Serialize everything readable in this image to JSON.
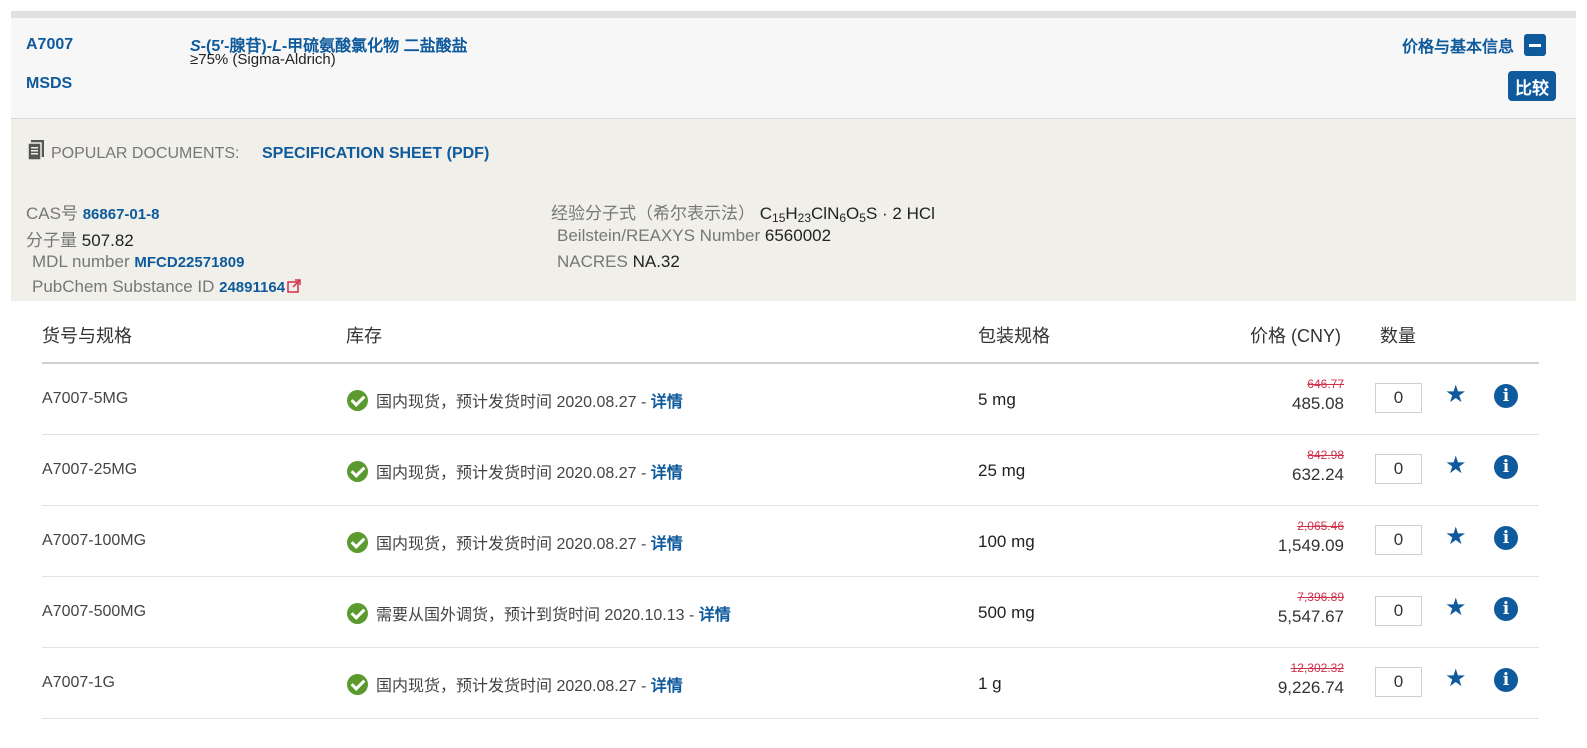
{
  "header": {
    "sku": "A7007",
    "msds": "MSDS",
    "product_name_prefix": "S",
    "product_name_mid": "-(5′-腺苷)-",
    "product_name_italic2": "L",
    "product_name_suffix": "-甲硫氨酸氯化物 二盐酸盐",
    "product_subtitle": "≥75% (Sigma-Aldrich)",
    "price_info_label": "价格与基本信息",
    "compare_label": "比较"
  },
  "docs": {
    "label": "POPULAR DOCUMENTS:",
    "link": "SPECIFICATION SHEET (PDF)"
  },
  "properties": {
    "cas_label": "CAS号",
    "cas_value": "86867-01-8",
    "mw_label": "分子量",
    "mw_value": "507.82",
    "mdl_label": "MDL number",
    "mdl_value": "MFCD22571809",
    "pubchem_label": "PubChem Substance ID",
    "pubchem_value": "24891164",
    "formula_label": "经验分子式（希尔表示法）",
    "formula_parts": [
      "C",
      "15",
      "H",
      "23",
      "ClN",
      "6",
      "O",
      "5",
      "S · 2 HCl"
    ],
    "beilstein_label": "Beilstein/REAXYS Number",
    "beilstein_value": "6560002",
    "nacres_label": "NACRES",
    "nacres_value": "NA.32"
  },
  "table": {
    "headers": [
      "货号与规格",
      "库存",
      "包装规格",
      "价格 (CNY)",
      "数量"
    ],
    "rows": [
      {
        "sku": "A7007-5MG",
        "stock": "国内现货，预计发货时间 2020.08.27 - ",
        "detail": "详情",
        "pack": "5 mg",
        "old_price": "646.77",
        "price": "485.08",
        "qty": "0"
      },
      {
        "sku": "A7007-25MG",
        "stock": "国内现货，预计发货时间 2020.08.27 - ",
        "detail": "详情",
        "pack": "25 mg",
        "old_price": "842.98",
        "price": "632.24",
        "qty": "0"
      },
      {
        "sku": "A7007-100MG",
        "stock": "国内现货，预计发货时间 2020.08.27 - ",
        "detail": "详情",
        "pack": "100 mg",
        "old_price": "2,065.46",
        "price": "1,549.09",
        "qty": "0"
      },
      {
        "sku": "A7007-500MG",
        "stock": "需要从国外调货，预计到货时间 2020.10.13 - ",
        "detail": "详情",
        "pack": "500 mg",
        "old_price": "7,396.89",
        "price": "5,547.67",
        "qty": "0"
      },
      {
        "sku": "A7007-1G",
        "stock": "国内现货，预计发货时间 2020.08.27 - ",
        "detail": "详情",
        "pack": "1 g",
        "old_price": "12,302.32",
        "price": "9,226.74",
        "qty": "0"
      }
    ]
  },
  "colors": {
    "link_blue": "#0e5a9c",
    "strike_red": "#d0314b",
    "check_green": "#5a9a2e",
    "doc_bg": "#f0efe9"
  },
  "icons": {
    "doc": "document-icon",
    "external": "external-link-icon",
    "check": "check-circle-icon",
    "star": "star-icon",
    "info": "info-icon",
    "collapse": "minus-icon"
  }
}
